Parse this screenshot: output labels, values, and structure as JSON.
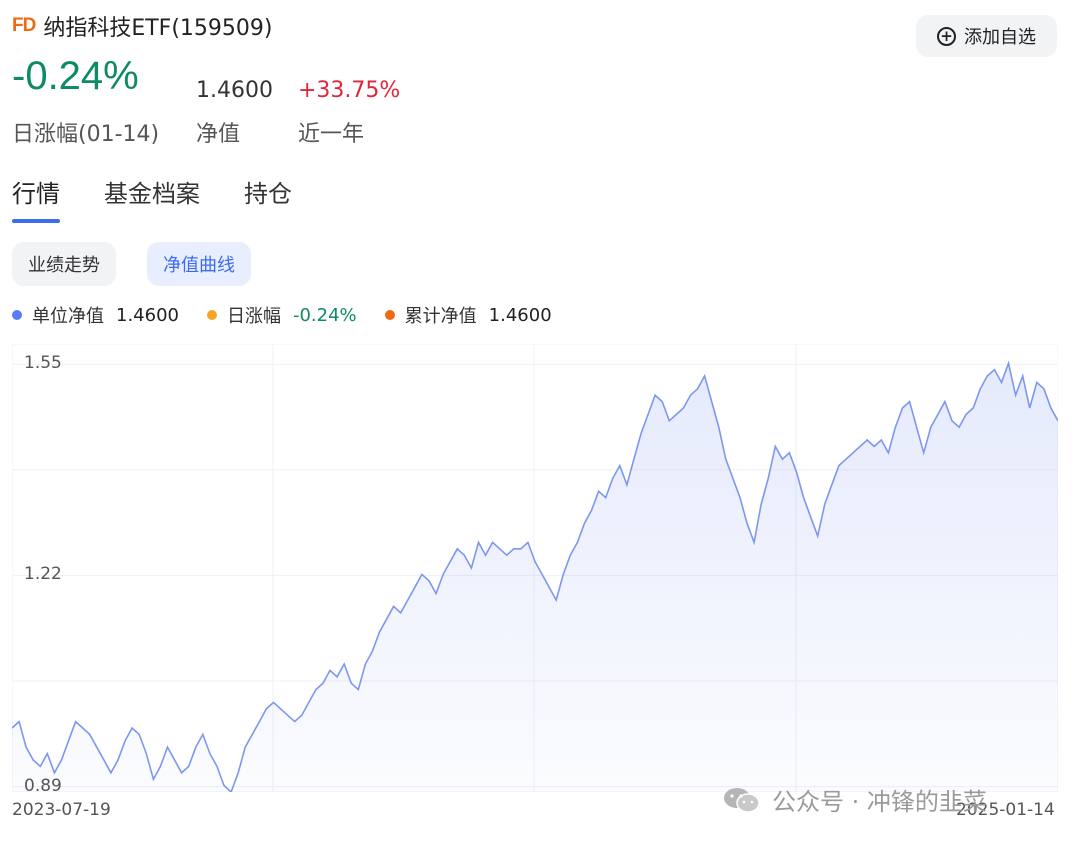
{
  "header": {
    "logo": "FD",
    "title": "纳指科技ETF(159509)",
    "add_button": "添加自选"
  },
  "metrics": {
    "daily_change": "-0.24%",
    "daily_label": "日涨幅(01-14)",
    "nav_value": "1.4600",
    "nav_label": "净值",
    "year_change": "+33.75%",
    "year_label": "近一年"
  },
  "tabs": [
    "行情",
    "基金档案",
    "持仓"
  ],
  "subtabs": [
    "业绩走势",
    "净值曲线"
  ],
  "legend": [
    {
      "label": "单位净值",
      "value": "1.4600",
      "color": "#5b7cf5"
    },
    {
      "label": "日涨幅",
      "value": "-0.24%",
      "color": "#f5a623"
    },
    {
      "label": "累计净值",
      "value": "1.4600",
      "color": "#f06a14"
    }
  ],
  "watermark": "公众号 · 冲锋的韭菜",
  "colors": {
    "accent": "#3d6cf0",
    "down": "#0f8a66",
    "up": "#e0263a",
    "line": "#7d96f0"
  },
  "chart_data": {
    "type": "area",
    "ylim": [
      0.88,
      1.58
    ],
    "yticks": [
      "1.55",
      "1.22",
      "0.89"
    ],
    "ytick_values": [
      1.55,
      1.22,
      0.89
    ],
    "x_start": "2023-07-19",
    "x_end": "2025-01-14",
    "series": [
      {
        "values": [
          0.98,
          0.99,
          0.95,
          0.93,
          0.92,
          0.94,
          0.91,
          0.93,
          0.96,
          0.99,
          0.98,
          0.97,
          0.95,
          0.93,
          0.91,
          0.93,
          0.96,
          0.98,
          0.97,
          0.94,
          0.9,
          0.92,
          0.95,
          0.93,
          0.91,
          0.92,
          0.95,
          0.97,
          0.94,
          0.92,
          0.89,
          0.88,
          0.91,
          0.95,
          0.97,
          0.99,
          1.01,
          1.02,
          1.01,
          1.0,
          0.99,
          1.0,
          1.02,
          1.04,
          1.05,
          1.07,
          1.06,
          1.08,
          1.05,
          1.04,
          1.08,
          1.1,
          1.13,
          1.15,
          1.17,
          1.16,
          1.18,
          1.2,
          1.22,
          1.21,
          1.19,
          1.22,
          1.24,
          1.26,
          1.25,
          1.23,
          1.27,
          1.25,
          1.27,
          1.26,
          1.25,
          1.26,
          1.26,
          1.27,
          1.24,
          1.22,
          1.2,
          1.18,
          1.22,
          1.25,
          1.27,
          1.3,
          1.32,
          1.35,
          1.34,
          1.37,
          1.39,
          1.36,
          1.4,
          1.44,
          1.47,
          1.5,
          1.49,
          1.46,
          1.47,
          1.48,
          1.5,
          1.51,
          1.53,
          1.49,
          1.45,
          1.4,
          1.37,
          1.34,
          1.3,
          1.27,
          1.33,
          1.37,
          1.42,
          1.4,
          1.41,
          1.38,
          1.34,
          1.31,
          1.28,
          1.33,
          1.36,
          1.39,
          1.4,
          1.41,
          1.42,
          1.43,
          1.42,
          1.43,
          1.41,
          1.45,
          1.48,
          1.49,
          1.45,
          1.41,
          1.45,
          1.47,
          1.49,
          1.46,
          1.45,
          1.47,
          1.48,
          1.51,
          1.53,
          1.54,
          1.52,
          1.55,
          1.5,
          1.53,
          1.48,
          1.52,
          1.51,
          1.48,
          1.46
        ]
      }
    ]
  }
}
